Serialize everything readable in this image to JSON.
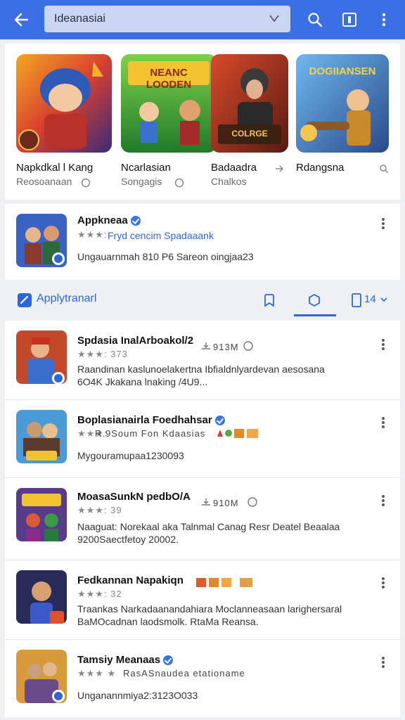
{
  "topbar": {
    "search_value": "Ideanasiai",
    "accent": "#3c6fe4",
    "icons": [
      "back-arrow-icon",
      "chevron-down-icon",
      "search-icon",
      "tablet-icon",
      "more-vert-icon"
    ]
  },
  "featured": [
    {
      "name": "Napkdkal l Kang",
      "sub": "Reosoanaan",
      "art_title": ""
    },
    {
      "name": "Ncarlasian",
      "sub": "Songagis",
      "art_title": "NEANC LOODEN"
    },
    {
      "name": "Badaadra",
      "sub": "Chalkos",
      "art_title": "COLRGE"
    },
    {
      "name": "Rdangsna",
      "sub": "",
      "art_title": "DOGIIANSEN"
    }
  ],
  "spotlight": {
    "title": "Appkneaa",
    "stars": "★★★:",
    "link": "Fryd cencim Spadaaank",
    "desc": "Ungauarnmah 810 P6 Sareon  oingjaa23"
  },
  "tabstrip": {
    "link": "Applytranarl",
    "count": "14"
  },
  "list": [
    {
      "title": "Spdasia InalArboakol/2",
      "stars": "★★★: 373",
      "meta": "913M",
      "desc1": "Raandinan kaslunoelakertna Ibfialdnlyardevan aesosana",
      "desc2": "6O4K Jkakana lnaking /4U9..."
    },
    {
      "title": "Boplasianairla Foedhahsar",
      "stars": "★★★: ",
      "meta": "R.9Soum Fon Kdaasias",
      "desc1": "Mygouramupaa1230093",
      "desc2": ""
    },
    {
      "title": "MoasaSunkN pedbO/A",
      "stars": "★★★: 39",
      "meta": "910M",
      "desc1": "Naaguat: Norekaal aka Talnmal Canag Resr Deatel Beaalaa",
      "desc2": "9200Saectfetoy 20002."
    },
    {
      "title": "Fedkannan Napakiqn",
      "stars": "★★★: 32",
      "meta": "",
      "desc1": "Traankas Narkadaanandahiara Moclanneasaan larighersaral",
      "desc2": "BaMOcadnan laodsmolk. RtaMa Reansa."
    },
    {
      "title": "Tamsiy Meanaas",
      "stars": "★★★ ★",
      "meta": "RasASnaudea etationame",
      "desc1": "Unganannmiya2:3123O033",
      "desc2": ""
    }
  ]
}
